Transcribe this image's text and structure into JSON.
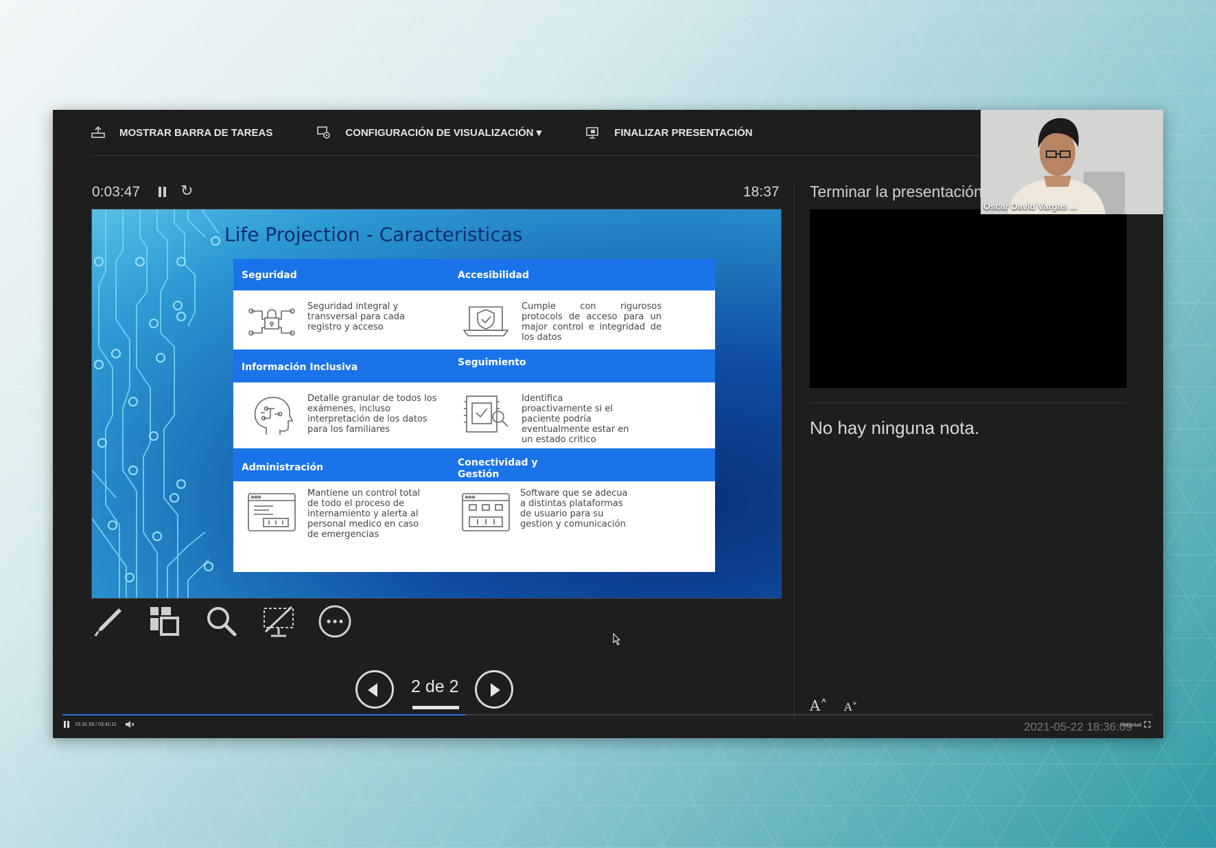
{
  "toolbar": {
    "show_taskbar": "MOSTRAR BARRA DE TAREAS",
    "display_settings": "CONFIGURACIÓN DE VISUALIZACIÓN ▾",
    "end_presentation": "FINALIZAR PRESENTACIÓN"
  },
  "timer": {
    "elapsed": "0:03:47",
    "clock": "18:37"
  },
  "slide": {
    "title": "Life Projection - Caracteristicas",
    "cells": [
      {
        "heading": "Seguridad",
        "text": "Seguridad integral y transversal para cada registro y acceso",
        "icon": "lock-network-icon"
      },
      {
        "heading": "Accesibilidad",
        "text": "Cumple con rigurosos protocols de acceso para un major control e integridad de los datos",
        "icon": "laptop-shield-icon"
      },
      {
        "heading": "Información Inclusiva",
        "text": "Detalle granular de todos los exámenes, incluso interpretación de los datos para los familiares",
        "icon": "head-circuit-icon"
      },
      {
        "heading": "Seguimiento",
        "text": "Identifica proactivamente si el paciente podría eventualmente estar en un estado critico",
        "icon": "chip-search-icon"
      },
      {
        "heading": "Administración",
        "text": "Mantiene un control total de todo el proceso de internamiento y alerta al personal medico en caso de emergencias",
        "icon": "browser-window-icon"
      },
      {
        "heading": "Conectividad y Gestión",
        "text": "Software que se adecua a distintas plataformas de usuario para su gestion y comunicación",
        "icon": "browser-grid-icon"
      }
    ]
  },
  "tools": [
    "pen-icon",
    "slides-grid-icon",
    "zoom-icon",
    "black-screen-icon",
    "more-options-icon"
  ],
  "navigation": {
    "counter": "2 de 2"
  },
  "right_pane": {
    "end_label": "Terminar la presentación",
    "notes": "No hay ninguna nota.",
    "font_increase": "A˄",
    "font_decrease": "A˅"
  },
  "webcam": {
    "name": "Oscar David Vargas ..."
  },
  "player": {
    "time": "01:31:53 / 03:41:11",
    "timestamp": "2021-05-22 18:36:09",
    "speed_label": "Velocidad",
    "progress": 0.37
  },
  "colors": {
    "accent": "#1a73e8",
    "window_bg": "#1e1e1e",
    "slide_title": "#0e2e6e"
  }
}
